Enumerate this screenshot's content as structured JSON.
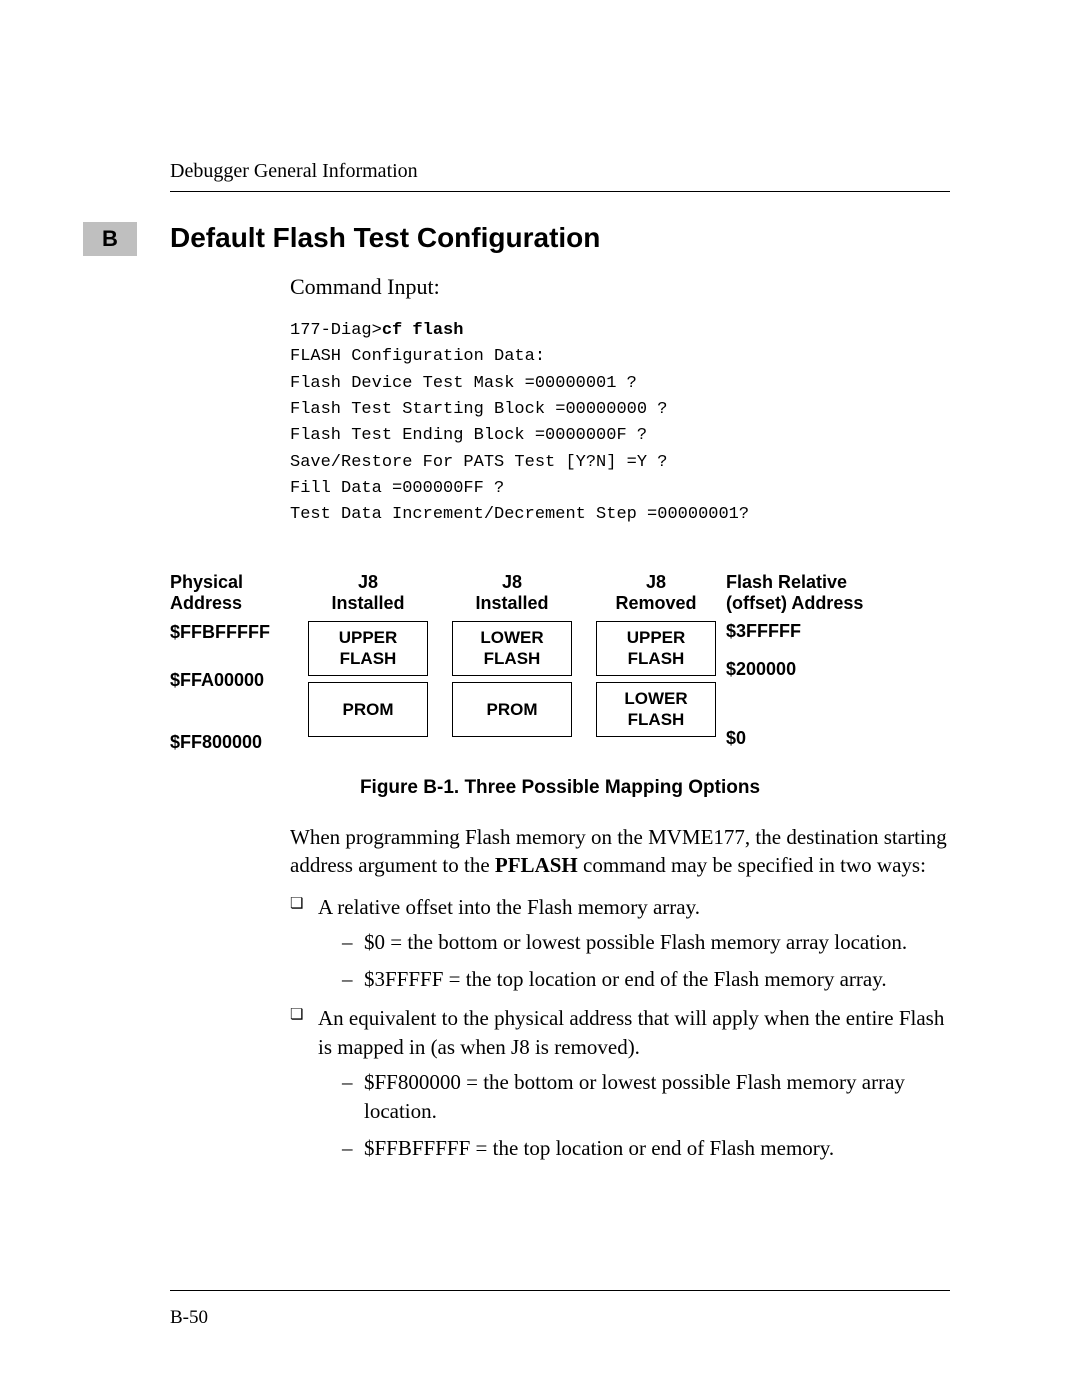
{
  "running_head": "Debugger General Information",
  "appendix_letter": "B",
  "section_title": "Default Flash Test Configuration",
  "command_input_label": "Command Input:",
  "code": {
    "prompt": "177-Diag>",
    "cmd": "cf flash",
    "lines": [
      "FLASH Configuration Data:",
      "Flash Device Test Mask =00000001 ?",
      "Flash Test Starting Block =00000000 ?",
      "Flash Test Ending Block =0000000F ?",
      "Save/Restore For PATS Test [Y?N] =Y ?",
      "Fill Data =000000FF ?",
      "Test Data Increment/Decrement Step =00000001?"
    ]
  },
  "figure": {
    "phys_hdr_l1": "Physical",
    "phys_hdr_l2": "Address",
    "phys": [
      "$FFBFFFFF",
      "$FFA00000",
      "$FF800000"
    ],
    "col1_hdr_l1": "J8",
    "col1_hdr_l2": "Installed",
    "col1_top_l1": "UPPER",
    "col1_top_l2": "FLASH",
    "col1_bot": "PROM",
    "col2_hdr_l1": "J8",
    "col2_hdr_l2": "Installed",
    "col2_top_l1": "LOWER",
    "col2_top_l2": "FLASH",
    "col2_bot": "PROM",
    "col3_hdr_l1": "J8",
    "col3_hdr_l2": "Removed",
    "col3_top_l1": "UPPER",
    "col3_top_l2": "FLASH",
    "col3_bot_l1": "LOWER",
    "col3_bot_l2": "FLASH",
    "rel_hdr_l1": "Flash Relative",
    "rel_hdr_l2": "(offset) Address",
    "rel": [
      "$3FFFFF",
      "$200000",
      "$0"
    ],
    "caption": "Figure B-1.  Three Possible Mapping Options"
  },
  "para1_a": "When programming Flash memory on the MVME177, the destination starting address argument to the ",
  "para1_bold": "PFLASH",
  "para1_b": " command may be specified in two ways:",
  "bullets": [
    {
      "text": "A relative offset into the Flash memory array.",
      "sub": [
        "$0 = the bottom or lowest possible Flash memory array location.",
        "$3FFFFF = the top location or end of the Flash memory array."
      ]
    },
    {
      "text": "An equivalent to the physical address that will apply when the entire Flash is mapped in (as when J8 is removed).",
      "sub": [
        "$FF800000 = the bottom or lowest possible Flash memory array location.",
        "$FFBFFFFF = the top location or end of Flash memory."
      ]
    }
  ],
  "page_number": "B-50"
}
